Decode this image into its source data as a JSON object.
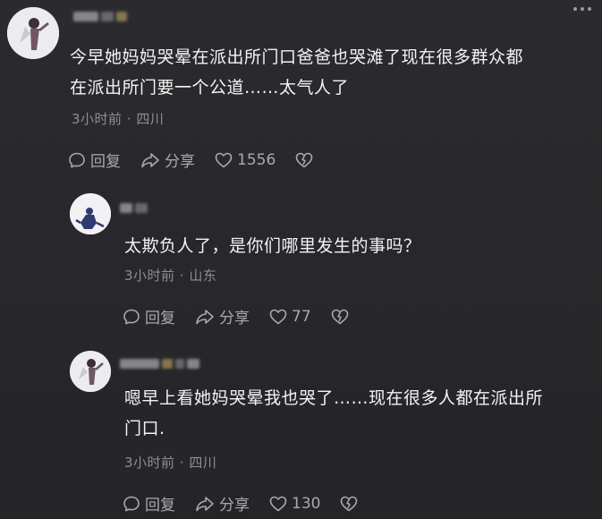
{
  "comments": [
    {
      "text": "今早她妈妈哭晕在派出所门口爸爸也哭滩了现在很多群众都在派出所门要一个公道……太气人了",
      "line1": "今早她妈妈哭晕在派出所门口爸爸也哭滩了现在很多群众都",
      "line2": "在派出所门要一个公道……太气人了",
      "meta": "3小时前 · 四川",
      "reply_label": "回复",
      "share_label": "分享",
      "like_count": "1556"
    },
    {
      "text": "太欺负人了，是你们哪里发生的事吗？",
      "meta": "3小时前 · 山东",
      "reply_label": "回复",
      "share_label": "分享",
      "like_count": "77"
    },
    {
      "text": "嗯早上看她妈哭晕我也哭了……现在很多人都在派出所门口.",
      "line1": "嗯早上看她妈哭晕我也哭了……现在很多人都在派出所",
      "line2": "门口.",
      "meta": "3小时前 · 四川",
      "reply_label": "回复",
      "share_label": "分享",
      "like_count": "130"
    }
  ],
  "colors": {
    "background": "#2a2a2e",
    "text": "#f3f3f3",
    "meta": "#8e8e93",
    "action": "#a8a8ad"
  },
  "icons": [
    "more-icon",
    "reply-icon",
    "share-icon",
    "like-icon",
    "dislike-icon"
  ]
}
